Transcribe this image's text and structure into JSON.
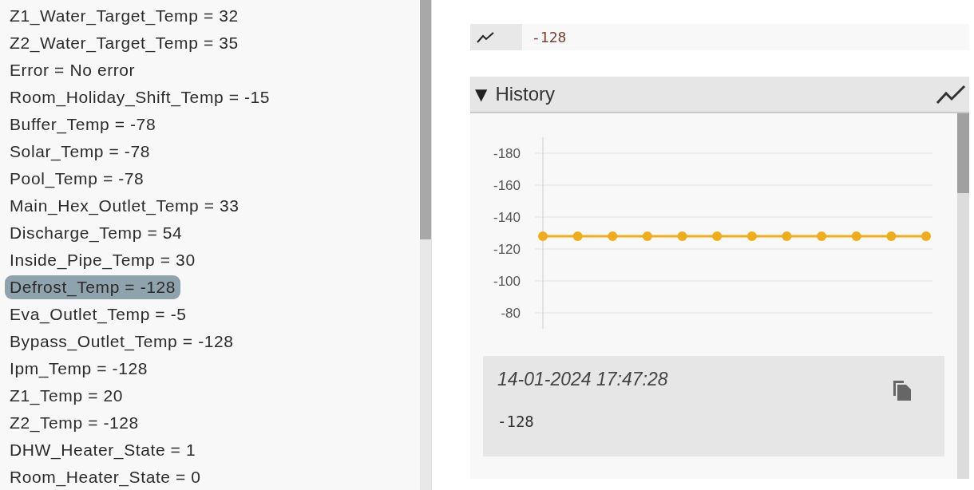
{
  "variables": [
    {
      "text": "Z1_Water_Target_Temp = 32",
      "selected": false
    },
    {
      "text": "Z2_Water_Target_Temp = 35",
      "selected": false
    },
    {
      "text": "Error = No error",
      "selected": false
    },
    {
      "text": "Room_Holiday_Shift_Temp = -15",
      "selected": false
    },
    {
      "text": "Buffer_Temp = -78",
      "selected": false
    },
    {
      "text": "Solar_Temp = -78",
      "selected": false
    },
    {
      "text": "Pool_Temp = -78",
      "selected": false
    },
    {
      "text": "Main_Hex_Outlet_Temp = 33",
      "selected": false
    },
    {
      "text": "Discharge_Temp = 54",
      "selected": false
    },
    {
      "text": "Inside_Pipe_Temp = 30",
      "selected": false
    },
    {
      "text": "Defrost_Temp = -128",
      "selected": true
    },
    {
      "text": "Eva_Outlet_Temp = -5",
      "selected": false
    },
    {
      "text": "Bypass_Outlet_Temp = -128",
      "selected": false
    },
    {
      "text": "Ipm_Temp = -128",
      "selected": false
    },
    {
      "text": "Z1_Temp = 20",
      "selected": false
    },
    {
      "text": "Z2_Temp = -128",
      "selected": false
    },
    {
      "text": "DHW_Heater_State = 1",
      "selected": false
    },
    {
      "text": "Room_Heater_State = 0",
      "selected": false
    }
  ],
  "value_field": {
    "value": "-128"
  },
  "history": {
    "title": "History",
    "expanded": true,
    "toggle": "▼",
    "chart_data": {
      "type": "line",
      "yticks": [
        -180,
        -160,
        -140,
        -120,
        -100,
        -80
      ],
      "ylim": [
        -70,
        -190
      ],
      "grid": true,
      "series": [
        {
          "marker": "circle",
          "color": "#f0ad1a",
          "values": [
            -128,
            -128,
            -128,
            -128,
            -128,
            -128,
            -128,
            -128,
            -128,
            -128,
            -128,
            -128
          ]
        }
      ]
    },
    "record": {
      "time": "14-01-2024 17:47:28",
      "value": "-128"
    }
  }
}
